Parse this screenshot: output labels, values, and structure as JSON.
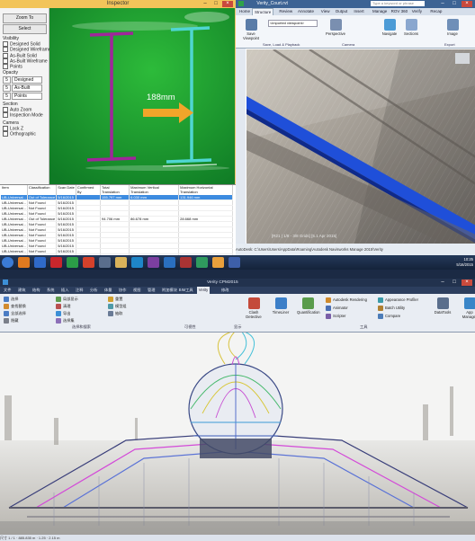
{
  "inspector": {
    "title": "Inspector",
    "zoom_to": "Zoom To",
    "select": "Select",
    "visibility_label": "Visibility",
    "visibility_items": [
      {
        "label": "Designed Solid",
        "checked": true
      },
      {
        "label": "Designed Wireframe",
        "checked": false
      },
      {
        "label": "As-Built Solid",
        "checked": true
      },
      {
        "label": "As-Built Wireframe",
        "checked": false
      },
      {
        "label": "Points",
        "checked": false
      }
    ],
    "opacity_label": "Opacity",
    "opacity_rows": [
      {
        "value": "5",
        "option": "Designed"
      },
      {
        "value": "5",
        "option": "As-Built"
      },
      {
        "value": "5",
        "option": "Points"
      }
    ],
    "section_label": "Section",
    "section_items": [
      {
        "label": "Auto Zoom",
        "checked": true
      },
      {
        "label": "Inspection Mode",
        "checked": true
      }
    ],
    "camera_label": "Camera",
    "camera_items": [
      {
        "label": "Lock Z",
        "checked": false
      },
      {
        "label": "Orthographic",
        "checked": true
      }
    ],
    "measurement": "188mm",
    "table": {
      "columns": [
        "Item",
        "Classification",
        "Scan Date",
        "Confirmed By",
        "Total Translation",
        "Maximum Vertical Translation",
        "Maximum Horizontal Translation"
      ],
      "rows": [
        [
          "UB-Universal...",
          "Out of Tolerance",
          "5/16/2015",
          "",
          "155.797 mm",
          "6.030 mm",
          "131.946 mm"
        ],
        [
          "UB-Universal...",
          "Not Found",
          "5/16/2015",
          "",
          "",
          "",
          ""
        ],
        [
          "UB-Universal...",
          "Not Found",
          "5/16/2015",
          "",
          "",
          "",
          ""
        ],
        [
          "UB-Universal...",
          "Not Found",
          "5/16/2015",
          "",
          "",
          "",
          ""
        ],
        [
          "UB-Universal...",
          "Out of Tolerance",
          "5/16/2015",
          "",
          "94.706 mm",
          "86.678 mm",
          "28.668 mm"
        ],
        [
          "UB-Universal...",
          "Not Found",
          "5/16/2015",
          "",
          "",
          "",
          ""
        ],
        [
          "UB-Universal...",
          "Not Found",
          "5/16/2015",
          "",
          "",
          "",
          ""
        ],
        [
          "UB-Universal...",
          "Not Found",
          "5/16/2015",
          "",
          "",
          "",
          ""
        ],
        [
          "UB-Universal...",
          "Not Found",
          "5/16/2015",
          "",
          "",
          "",
          ""
        ],
        [
          "UB-Universal...",
          "Not Found",
          "5/16/2015",
          "",
          "",
          "",
          ""
        ],
        [
          "UB-Universal...",
          "Not Found",
          "5/16/2015",
          "",
          "",
          "",
          ""
        ],
        [
          "UB-Universal...",
          "Not Found",
          "5/16/2015",
          "",
          "",
          "",
          ""
        ]
      ],
      "selected_row": 0
    }
  },
  "revit_top": {
    "title": "Verity_Court.rvt",
    "search_placeholder": "Type a keyword or phrase",
    "tabs": [
      "Home",
      "Structure",
      "Review",
      "Annotate",
      "View",
      "Output",
      "Insert",
      "Manage",
      "ROV 360",
      "Verify",
      "Recap"
    ],
    "active_tab": "Structure",
    "buttons": [
      "Save Viewpoint",
      "Perspective",
      "Navigate",
      "Sections",
      "Image"
    ],
    "dropdown_value": "<imported viewpoint>",
    "panels": [
      "Save, Load & Playback",
      "Camera",
      "Export"
    ],
    "status": "AutoDesk: C:\\Users\\Users\\AppData\\Roaming\\Autodesk Navisworks Manage 2015\\Verity",
    "view_label": "[R21 | 1/8 - 3/8 Grids] [5.1 Apr 2015]"
  },
  "revit_bottom": {
    "title": "Verity CPM2015",
    "tabs": [
      "文件",
      "建筑",
      "结构",
      "系统",
      "插入",
      "注释",
      "分析",
      "体量",
      "协作",
      "视图",
      "管理",
      "附加模块",
      "BIM工具",
      "Verity",
      "修改"
    ],
    "active_tab": "Verity",
    "small_items": [
      "选择",
      "查找替换",
      "全部选择",
      "隐藏",
      "局部显示",
      "清理",
      "导出",
      "选择集",
      "重置",
      "模型组",
      "抽取"
    ],
    "big_buttons": [
      "Clash Detective",
      "TimeLiner",
      "Quantification",
      "Autodesk Rendering",
      "Animator",
      "Scripter",
      "Appearance Profiler",
      "Batch Utility",
      "Compare",
      "DataTools",
      "App Manager"
    ],
    "groups": [
      "选择和搜索",
      "可视性",
      "显示",
      "工具"
    ],
    "status": "尺寸 1 / 1 · 885.835 m · 1.25 · 2.15 m"
  },
  "taskbar": {
    "time": "10:25",
    "date": "5/16/2015"
  }
}
